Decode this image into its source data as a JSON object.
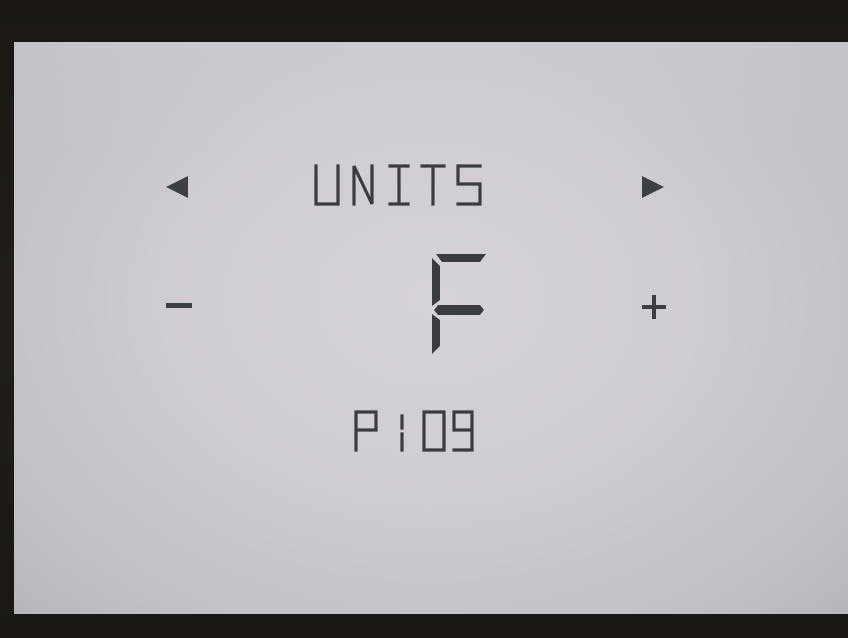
{
  "screen": {
    "menu_title": "UNITS",
    "value": "F",
    "parameter_code": "P109",
    "controls": {
      "prev_icon": "left-triangle-icon",
      "next_icon": "right-triangle-icon",
      "decrement_symbol": "−",
      "increment_symbol": "+"
    },
    "colors": {
      "lcd_background": "#cfccd2",
      "segment": "#3a3c40",
      "bezel": "#1a1712"
    }
  }
}
